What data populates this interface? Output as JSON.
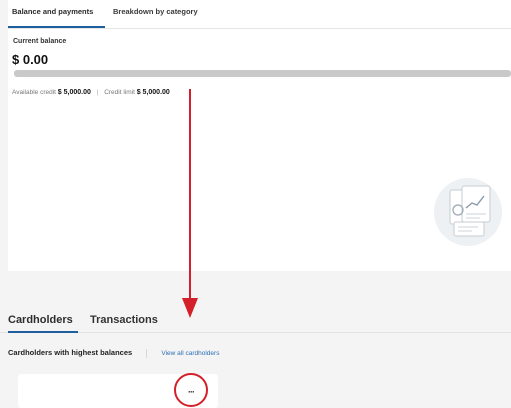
{
  "top_tabs": {
    "balance_payments": "Balance and payments",
    "breakdown": "Breakdown by category"
  },
  "balance": {
    "label": "Current balance",
    "value": "$ 0.00",
    "used_fraction": 0.0
  },
  "credit": {
    "available_label": "Available credit",
    "available_value": "$ 5,000.00",
    "separator": "|",
    "limit_label": "Credit limit",
    "limit_value": "$ 5,000.00"
  },
  "bottom_tabs": {
    "cardholders": "Cardholders",
    "transactions": "Transactions"
  },
  "section": {
    "title": "Cardholders with highest balances",
    "view_all": "View all cardholders"
  },
  "card": {
    "more_label": "···"
  },
  "colors": {
    "accent": "#1f5f9e",
    "annotation": "#d4202a",
    "link": "#2c6fb5"
  },
  "icons": {
    "illustration": "document-chart-illustration-icon",
    "arrow": "red-annotation-arrow-icon",
    "circle": "red-annotation-circle-icon"
  }
}
